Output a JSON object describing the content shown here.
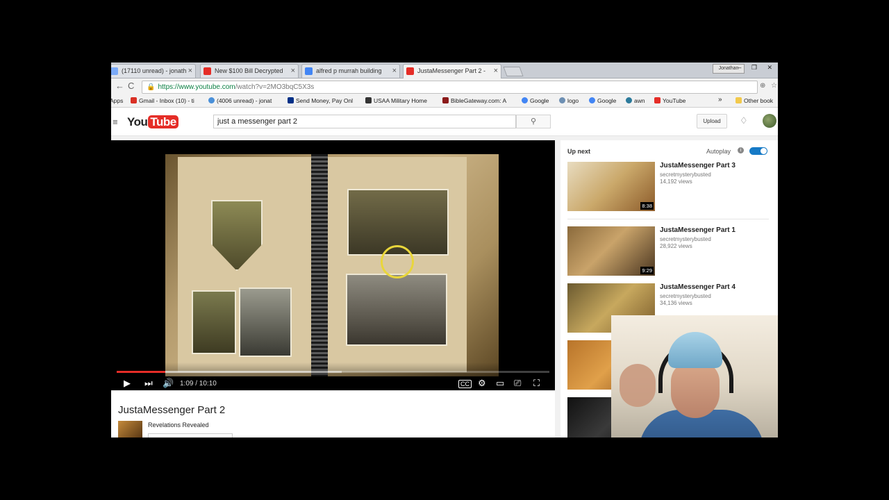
{
  "browser": {
    "tabs": [
      {
        "label": "(17110 unread) - jonath",
        "favicon_color": "#7baaf7"
      },
      {
        "label": "New $100 Bill Decrypted",
        "favicon_color": "#e52d27"
      },
      {
        "label": "alfred p murrah building",
        "favicon_color": "#4285f4"
      },
      {
        "label": "JustaMessenger Part 2 -",
        "favicon_color": "#e52d27"
      }
    ],
    "tab_close": "×",
    "user_chip": "Jonathan",
    "window_controls": "‒ ❐ ✕",
    "nav": {
      "back": "←",
      "forward": "→",
      "reload": "C"
    },
    "url_host": "https://www.youtube.com",
    "url_path": "/watch?v=2MO3bqC5X3s",
    "bookmarks": [
      {
        "label": "Apps",
        "icon_color": ""
      },
      {
        "label": "Gmail - Inbox (10) - ti",
        "icon_color": "#d93025"
      },
      {
        "label": "(4006 unread) - jonat",
        "icon_color": "#4a90d9"
      },
      {
        "label": "Send Money, Pay Onl",
        "icon_color": "#003087"
      },
      {
        "label": "USAA Military Home",
        "icon_color": "#333"
      },
      {
        "label": "BibleGateway.com: A",
        "icon_color": "#8b1a1a"
      },
      {
        "label": "Google",
        "icon_color": "#4285f4"
      },
      {
        "label": "logo",
        "icon_color": "#6d8fb3"
      },
      {
        "label": "Google",
        "icon_color": "#4285f4"
      },
      {
        "label": "awn",
        "icon_color": "#2b7a9b"
      },
      {
        "label": "YouTube",
        "icon_color": "#e52d27"
      }
    ],
    "bookmarks_more": "»",
    "other_bookmarks": "Other book"
  },
  "youtube": {
    "menu_icon": "≡",
    "logo_you": "You",
    "logo_tube": "Tube",
    "search_value": "just a messenger part 2",
    "search_icon": "⚲",
    "upload_label": "Upload",
    "bell_icon": "🔔"
  },
  "player": {
    "current_time": "1:09",
    "duration": "10:10",
    "time_display": "1:09 / 10:10",
    "played_fraction": 0.113,
    "buffered_fraction": 0.52,
    "icons": {
      "play": "▶",
      "next": "⏭",
      "volume": "🔊",
      "captions": "CC",
      "settings": "⚙",
      "theater": "▭",
      "cast": "⎚",
      "fullscreen": "⛶"
    }
  },
  "video": {
    "title": "JustaMessenger Part 2",
    "channel": "Revelations Revealed"
  },
  "sidebar": {
    "up_next": "Up next",
    "autoplay": "Autoplay",
    "autoplay_on": true,
    "info_icon": "i",
    "recommendations": [
      {
        "title": "JustaMessenger Part 3",
        "channel": "secretmysterybusted",
        "views": "14,192 views",
        "duration": "8:38"
      },
      {
        "title": "JustaMessenger Part 1",
        "channel": "secretmysterybusted",
        "views": "28,922 views",
        "duration": "9:29"
      },
      {
        "title": "JustaMessenger Part 4",
        "channel": "secretmysterybusted",
        "views": "34,136 views",
        "duration": ""
      }
    ]
  }
}
